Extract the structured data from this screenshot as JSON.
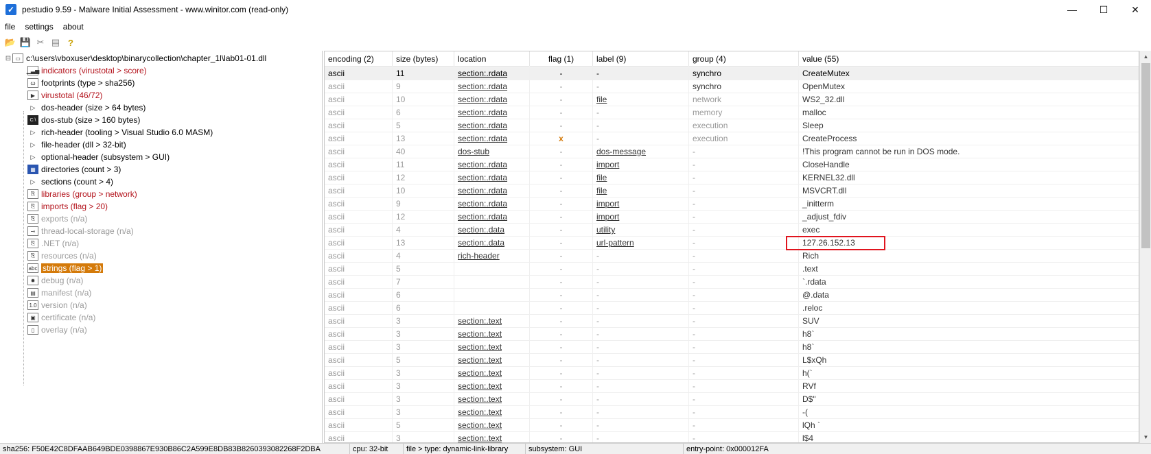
{
  "window": {
    "title": "pestudio 9.59 - Malware Initial Assessment - www.winitor.com (read-only)",
    "minimize": "—",
    "maximize": "☐",
    "close": "✕"
  },
  "menu": [
    "file",
    "settings",
    "about"
  ],
  "toolbar": {
    "icons": [
      "open-folder-icon",
      "save-icon",
      "close-file-icon",
      "list-icon",
      "help-icon"
    ]
  },
  "tree": {
    "root": "c:\\users\\vboxuser\\desktop\\binarycollection\\chapter_1l\\lab01-01.dll",
    "items": [
      {
        "label": "indicators (virustotal > score)",
        "style": "red",
        "icon": "chart-icon",
        "glyph": "▁▃▅"
      },
      {
        "label": "footprints (type > sha256)",
        "style": "normal",
        "icon": "footprint-icon",
        "glyph": "ꞷ"
      },
      {
        "label": "virustotal (46/72)",
        "style": "red",
        "icon": "virustotal-icon",
        "glyph": "▶"
      },
      {
        "label": "dos-header (size > 64 bytes)",
        "style": "normal",
        "icon": "expand-icon",
        "glyph": "▷"
      },
      {
        "label": "dos-stub (size > 160 bytes)",
        "style": "normal",
        "icon": "console-icon",
        "glyph": "C:\\"
      },
      {
        "label": "rich-header (tooling > Visual Studio 6.0 MASM)",
        "style": "normal",
        "icon": "expand-icon",
        "glyph": "▷"
      },
      {
        "label": "file-header (dll > 32-bit)",
        "style": "normal",
        "icon": "expand-icon",
        "glyph": "▷"
      },
      {
        "label": "optional-header (subsystem > GUI)",
        "style": "normal",
        "icon": "expand-icon",
        "glyph": "▷"
      },
      {
        "label": "directories (count > 3)",
        "style": "normal",
        "icon": "directories-icon",
        "glyph": "▦"
      },
      {
        "label": "sections (count > 4)",
        "style": "normal",
        "icon": "expand-icon",
        "glyph": "▷"
      },
      {
        "label": "libraries (group > network)",
        "style": "red",
        "icon": "library-icon",
        "glyph": "⎘"
      },
      {
        "label": "imports (flag > 20)",
        "style": "red",
        "icon": "imports-icon",
        "glyph": "⎘"
      },
      {
        "label": "exports (n/a)",
        "style": "gray",
        "icon": "exports-icon",
        "glyph": "⎘"
      },
      {
        "label": "thread-local-storage (n/a)",
        "style": "gray",
        "icon": "tls-icon",
        "glyph": "⊸"
      },
      {
        "label": ".NET (n/a)",
        "style": "gray",
        "icon": "dotnet-icon",
        "glyph": "⎘"
      },
      {
        "label": "resources (n/a)",
        "style": "gray",
        "icon": "resources-icon",
        "glyph": "⎘"
      },
      {
        "label": "strings (flag > 1)",
        "style": "selected",
        "icon": "strings-icon",
        "glyph": "abc"
      },
      {
        "label": "debug (n/a)",
        "style": "gray",
        "icon": "debug-icon",
        "glyph": "✹"
      },
      {
        "label": "manifest (n/a)",
        "style": "gray",
        "icon": "manifest-icon",
        "glyph": "▤"
      },
      {
        "label": "version (n/a)",
        "style": "gray",
        "icon": "version-icon",
        "glyph": "1.0"
      },
      {
        "label": "certificate (n/a)",
        "style": "gray",
        "icon": "certificate-icon",
        "glyph": "▣"
      },
      {
        "label": "overlay (n/a)",
        "style": "gray",
        "icon": "overlay-icon",
        "glyph": "▯"
      }
    ]
  },
  "table": {
    "columns": [
      "encoding (2)",
      "size (bytes)",
      "location",
      "flag (1)",
      "label (9)",
      "group (4)",
      "value (55)"
    ],
    "rows": [
      [
        "ascii",
        "11",
        "section:.rdata",
        "-",
        "-",
        "synchro",
        "CreateMutex"
      ],
      [
        "ascii",
        "9",
        "section:.rdata",
        "-",
        "-",
        "synchro",
        "OpenMutex"
      ],
      [
        "ascii",
        "10",
        "section:.rdata",
        "-",
        "file",
        "network",
        "WS2_32.dll"
      ],
      [
        "ascii",
        "6",
        "section:.rdata",
        "-",
        "-",
        "memory",
        "malloc"
      ],
      [
        "ascii",
        "5",
        "section:.rdata",
        "-",
        "-",
        "execution",
        "Sleep"
      ],
      [
        "ascii",
        "13",
        "section:.rdata",
        "x",
        "-",
        "execution",
        "CreateProcess"
      ],
      [
        "ascii",
        "40",
        "dos-stub",
        "-",
        "dos-message",
        "-",
        "!This program cannot be run in DOS mode."
      ],
      [
        "ascii",
        "11",
        "section:.rdata",
        "-",
        "import",
        "-",
        "CloseHandle"
      ],
      [
        "ascii",
        "12",
        "section:.rdata",
        "-",
        "file",
        "-",
        "KERNEL32.dll"
      ],
      [
        "ascii",
        "10",
        "section:.rdata",
        "-",
        "file",
        "-",
        "MSVCRT.dll"
      ],
      [
        "ascii",
        "9",
        "section:.rdata",
        "-",
        "import",
        "-",
        "_initterm"
      ],
      [
        "ascii",
        "12",
        "section:.rdata",
        "-",
        "import",
        "-",
        "_adjust_fdiv"
      ],
      [
        "ascii",
        "4",
        "section:.data",
        "-",
        "utility",
        "-",
        "exec"
      ],
      [
        "ascii",
        "13",
        "section:.data",
        "-",
        "url-pattern",
        "-",
        "127.26.152.13"
      ],
      [
        "ascii",
        "4",
        "rich-header",
        "-",
        "-",
        "-",
        "Rich"
      ],
      [
        "ascii",
        "5",
        "",
        "-",
        "-",
        "-",
        ".text"
      ],
      [
        "ascii",
        "7",
        "",
        "-",
        "-",
        "-",
        "`.rdata"
      ],
      [
        "ascii",
        "6",
        "",
        "-",
        "-",
        "-",
        "@.data"
      ],
      [
        "ascii",
        "6",
        "",
        "-",
        "-",
        "-",
        ".reloc"
      ],
      [
        "ascii",
        "3",
        "section:.text",
        "-",
        "-",
        "-",
        "SUV"
      ],
      [
        "ascii",
        "3",
        "section:.text",
        "-",
        "-",
        "-",
        "h8`"
      ],
      [
        "ascii",
        "3",
        "section:.text",
        "-",
        "-",
        "-",
        "h8`"
      ],
      [
        "ascii",
        "5",
        "section:.text",
        "-",
        "-",
        "-",
        "L$xQh"
      ],
      [
        "ascii",
        "3",
        "section:.text",
        "-",
        "-",
        "-",
        "h(`"
      ],
      [
        "ascii",
        "3",
        "section:.text",
        "-",
        "-",
        "-",
        "RVf"
      ],
      [
        "ascii",
        "3",
        "section:.text",
        "-",
        "-",
        "-",
        "D$\""
      ],
      [
        "ascii",
        "3",
        "section:.text",
        "-",
        "-",
        "-",
        "-("
      ],
      [
        "ascii",
        "5",
        "section:.text",
        "-",
        "-",
        "-",
        "lQh `"
      ],
      [
        "ascii",
        "3",
        "section:.text",
        "-",
        "-",
        "-",
        "l$4"
      ]
    ]
  },
  "status": {
    "sha256": "sha256: F50E42C8DFAAB649BDE0398867E930B86C2A599E8DB83B8260393082268F2DBA",
    "cpu": "cpu: 32-bit",
    "type": "file > type: dynamic-link-library",
    "subsystem": "subsystem: GUI",
    "entry": "entry-point: 0x000012FA"
  },
  "colors": {
    "accent": "#d47a0a",
    "flag_red": "#b3121b",
    "highlight": "#e0141e"
  }
}
